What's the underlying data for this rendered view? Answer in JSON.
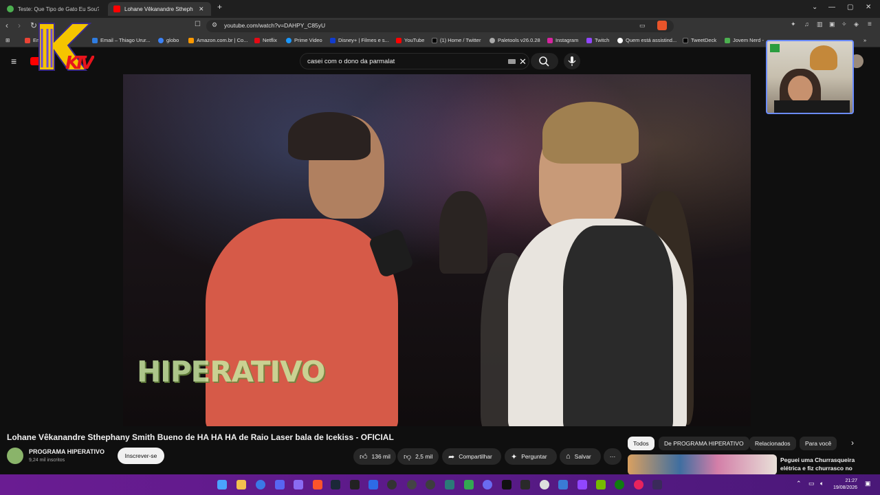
{
  "browser": {
    "tabs": [
      {
        "title": "Teste: Que Tipo de Gato Eu Sou? - e",
        "active": false
      },
      {
        "title": "Lohane Vêkanandre Sthepha",
        "active": true
      }
    ],
    "url": "youtube.com/watch?v=DAHPY_C85yU",
    "bookmarks": [
      "Em",
      "Email – Thiago Urur...",
      "globo",
      "Amazon.com.br | Co...",
      "Netflix",
      "Prime Video",
      "Disney+ | Filmes e s...",
      "YouTube",
      "(1) Home / Twitter",
      "Paletools v26.0.28",
      "Instagram",
      "Twitch",
      "Quem está assistind...",
      "TweetDeck",
      "Jovem Nerd -"
    ]
  },
  "youtube": {
    "search_query": "casei com o dono da parmalat",
    "video": {
      "watermark": "HIPERATIVO",
      "title": "Lohane Vêkanandre Sthephany Smith Bueno de HA HA HA de Raio Laser bala de Icekiss - OFICIAL"
    },
    "channel": {
      "name": "PROGRAMA HIPERATIVO",
      "subscribers": "9,24 mil inscritos",
      "subscribe_label": "Inscrever-se"
    },
    "actions": {
      "likes": "136 mil",
      "dislikes": "2,5 mil",
      "share": "Compartilhar",
      "ask": "Perguntar",
      "save": "Salvar"
    },
    "chips": [
      "Todos",
      "De PROGRAMA HIPERATIVO",
      "Relacionados",
      "Para você"
    ],
    "recommendation": {
      "title": "Peguei uma Churrasqueira elétrica e fiz churrasco no"
    }
  },
  "overlay": {
    "logo_text": "KTV"
  },
  "taskbar": {
    "time": "21:27",
    "date": "19/08/2026"
  }
}
